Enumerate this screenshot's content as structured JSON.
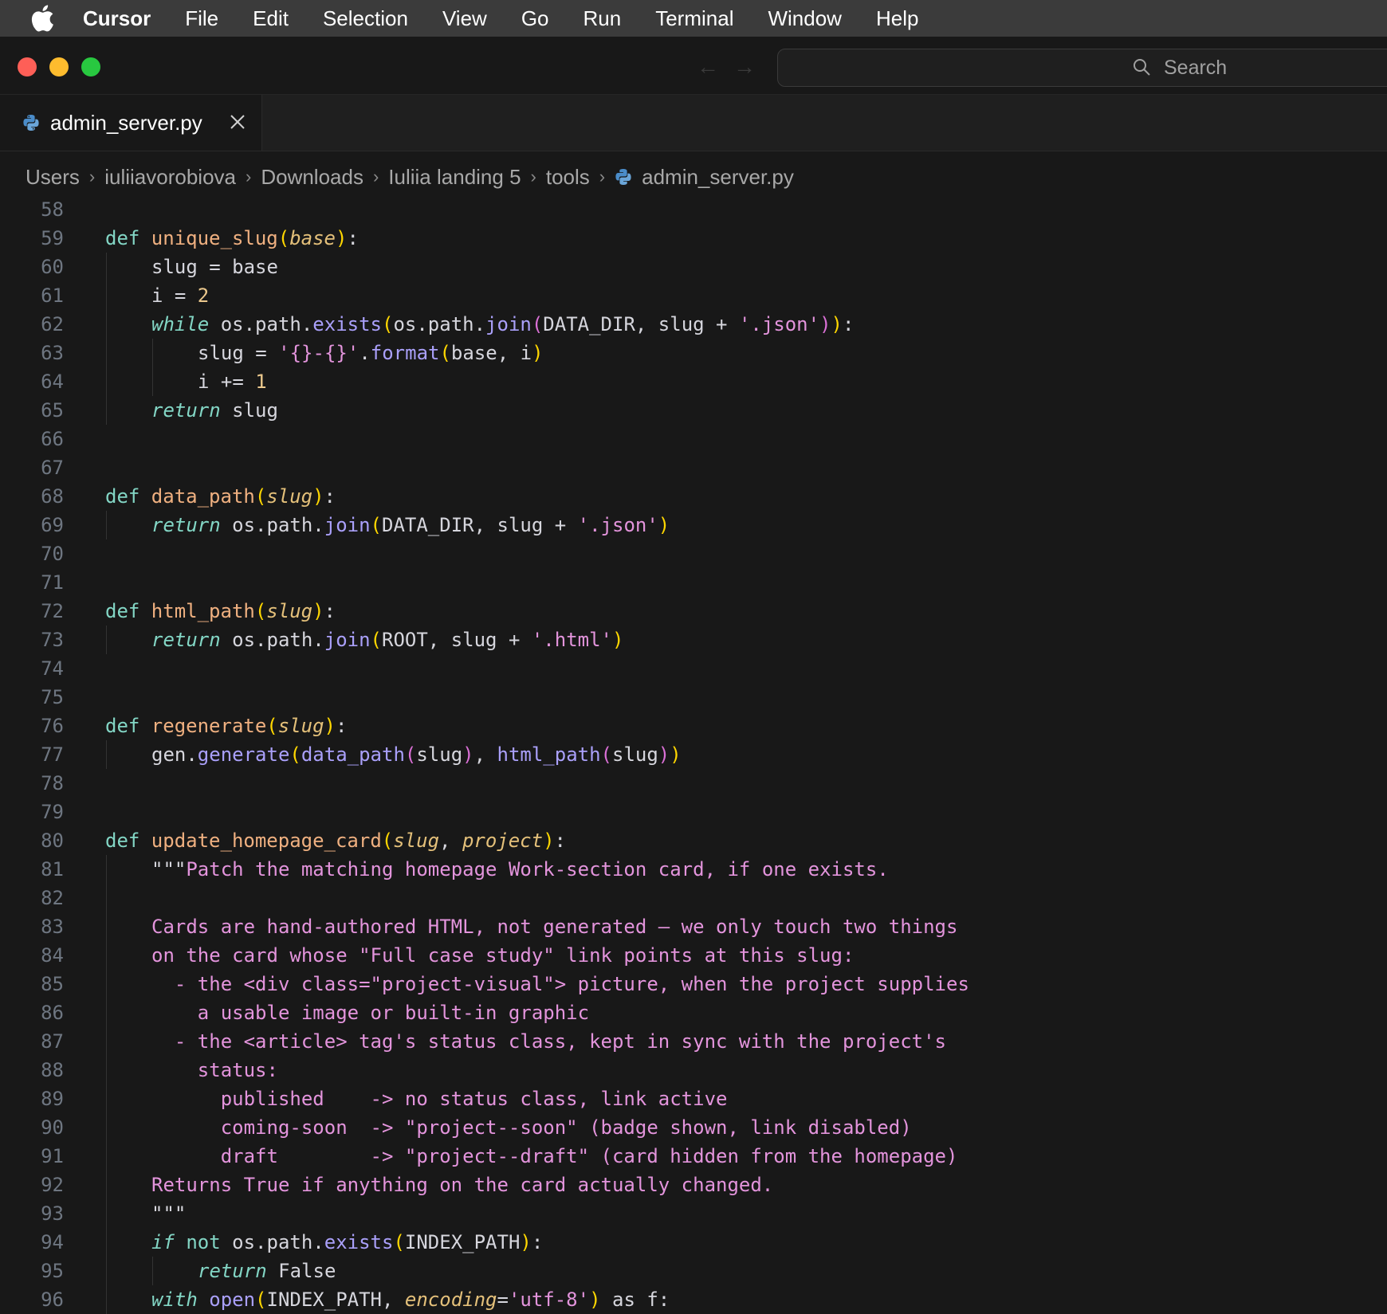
{
  "menubar": {
    "app_name": "Cursor",
    "items": [
      "File",
      "Edit",
      "Selection",
      "View",
      "Go",
      "Run",
      "Terminal",
      "Window",
      "Help"
    ]
  },
  "titlebar": {
    "search_placeholder": "Search"
  },
  "tab": {
    "filename": "admin_server.py"
  },
  "breadcrumb": [
    "Users",
    "iuliiavorobiova",
    "Downloads",
    "Iuliia landing 5",
    "tools",
    "admin_server.py"
  ],
  "colors": {
    "background": "#181818",
    "keyword": "#83d6c5",
    "function": "#efb080",
    "string": "#e394dc",
    "number": "#ebc88d",
    "method": "#aaa0fa"
  },
  "code_lines": [
    {
      "n": "58",
      "indent": 0,
      "tokens": []
    },
    {
      "n": "59",
      "indent": 0,
      "tokens": [
        [
          "kw",
          "def "
        ],
        [
          "fn",
          "unique_slug"
        ],
        [
          "b1",
          "("
        ],
        [
          "par",
          "base"
        ],
        [
          "b1",
          ")"
        ],
        [
          "pl",
          ":"
        ]
      ]
    },
    {
      "n": "60",
      "indent": 1,
      "tokens": [
        [
          "txt",
          "slug = base"
        ]
      ]
    },
    {
      "n": "61",
      "indent": 1,
      "tokens": [
        [
          "txt",
          "i = "
        ],
        [
          "num",
          "2"
        ]
      ]
    },
    {
      "n": "62",
      "indent": 1,
      "tokens": [
        [
          "it",
          "while"
        ],
        [
          "txt",
          " os.path."
        ],
        [
          "call",
          "exists"
        ],
        [
          "b1",
          "("
        ],
        [
          "txt",
          "os.path."
        ],
        [
          "call",
          "join"
        ],
        [
          "b2",
          "("
        ],
        [
          "txt",
          "DATA_DIR, slug + "
        ],
        [
          "str",
          "'.json'"
        ],
        [
          "b2",
          ")"
        ],
        [
          "b1",
          ")"
        ],
        [
          "pl",
          ":"
        ]
      ]
    },
    {
      "n": "63",
      "indent": 2,
      "tokens": [
        [
          "txt",
          "slug = "
        ],
        [
          "str",
          "'{}-{}'"
        ],
        [
          "txt",
          "."
        ],
        [
          "call",
          "format"
        ],
        [
          "b1",
          "("
        ],
        [
          "txt",
          "base, i"
        ],
        [
          "b1",
          ")"
        ]
      ]
    },
    {
      "n": "64",
      "indent": 2,
      "tokens": [
        [
          "txt",
          "i += "
        ],
        [
          "num",
          "1"
        ]
      ]
    },
    {
      "n": "65",
      "indent": 1,
      "tokens": [
        [
          "it",
          "return"
        ],
        [
          "txt",
          " slug"
        ]
      ]
    },
    {
      "n": "66",
      "indent": 0,
      "tokens": []
    },
    {
      "n": "67",
      "indent": 0,
      "tokens": []
    },
    {
      "n": "68",
      "indent": 0,
      "tokens": [
        [
          "kw",
          "def "
        ],
        [
          "fn",
          "data_path"
        ],
        [
          "b1",
          "("
        ],
        [
          "par",
          "slug"
        ],
        [
          "b1",
          ")"
        ],
        [
          "pl",
          ":"
        ]
      ]
    },
    {
      "n": "69",
      "indent": 1,
      "tokens": [
        [
          "it",
          "return"
        ],
        [
          "txt",
          " os.path."
        ],
        [
          "call",
          "join"
        ],
        [
          "b1",
          "("
        ],
        [
          "txt",
          "DATA_DIR, slug + "
        ],
        [
          "str",
          "'.json'"
        ],
        [
          "b1",
          ")"
        ]
      ]
    },
    {
      "n": "70",
      "indent": 0,
      "tokens": []
    },
    {
      "n": "71",
      "indent": 0,
      "tokens": []
    },
    {
      "n": "72",
      "indent": 0,
      "tokens": [
        [
          "kw",
          "def "
        ],
        [
          "fn",
          "html_path"
        ],
        [
          "b1",
          "("
        ],
        [
          "par",
          "slug"
        ],
        [
          "b1",
          ")"
        ],
        [
          "pl",
          ":"
        ]
      ]
    },
    {
      "n": "73",
      "indent": 1,
      "tokens": [
        [
          "it",
          "return"
        ],
        [
          "txt",
          " os.path."
        ],
        [
          "call",
          "join"
        ],
        [
          "b1",
          "("
        ],
        [
          "txt",
          "ROOT, slug + "
        ],
        [
          "str",
          "'.html'"
        ],
        [
          "b1",
          ")"
        ]
      ]
    },
    {
      "n": "74",
      "indent": 0,
      "tokens": []
    },
    {
      "n": "75",
      "indent": 0,
      "tokens": []
    },
    {
      "n": "76",
      "indent": 0,
      "tokens": [
        [
          "kw",
          "def "
        ],
        [
          "fn",
          "regenerate"
        ],
        [
          "b1",
          "("
        ],
        [
          "par",
          "slug"
        ],
        [
          "b1",
          ")"
        ],
        [
          "pl",
          ":"
        ]
      ]
    },
    {
      "n": "77",
      "indent": 1,
      "tokens": [
        [
          "txt",
          "gen."
        ],
        [
          "call",
          "generate"
        ],
        [
          "b1",
          "("
        ],
        [
          "call",
          "data_path"
        ],
        [
          "b2",
          "("
        ],
        [
          "txt",
          "slug"
        ],
        [
          "b2",
          ")"
        ],
        [
          "txt",
          ", "
        ],
        [
          "call",
          "html_path"
        ],
        [
          "b2",
          "("
        ],
        [
          "txt",
          "slug"
        ],
        [
          "b2",
          ")"
        ],
        [
          "b1",
          ")"
        ]
      ]
    },
    {
      "n": "78",
      "indent": 0,
      "tokens": []
    },
    {
      "n": "79",
      "indent": 0,
      "tokens": []
    },
    {
      "n": "80",
      "indent": 0,
      "tokens": [
        [
          "kw",
          "def "
        ],
        [
          "fn",
          "update_homepage_card"
        ],
        [
          "b1",
          "("
        ],
        [
          "par",
          "slug"
        ],
        [
          "txt",
          ", "
        ],
        [
          "par",
          "project"
        ],
        [
          "b1",
          ")"
        ],
        [
          "pl",
          ":"
        ]
      ]
    },
    {
      "n": "81",
      "indent": 1,
      "tokens": [
        [
          "txt",
          "\"\"\""
        ],
        [
          "doc",
          "Patch the matching homepage Work-section card, if one exists."
        ]
      ]
    },
    {
      "n": "82",
      "indent": 1,
      "tokens": []
    },
    {
      "n": "83",
      "indent": 1,
      "tokens": [
        [
          "doc",
          "Cards are hand-authored HTML, not generated — we only touch two things"
        ]
      ]
    },
    {
      "n": "84",
      "indent": 1,
      "tokens": [
        [
          "doc",
          "on the card whose \"Full case study\" link points at this slug:"
        ]
      ]
    },
    {
      "n": "85",
      "indent": 1,
      "tokens": [
        [
          "doc",
          "  - the <div class=\"project-visual\"> picture, when the project supplies"
        ]
      ]
    },
    {
      "n": "86",
      "indent": 1,
      "tokens": [
        [
          "doc",
          "    a usable image or built-in graphic"
        ]
      ]
    },
    {
      "n": "87",
      "indent": 1,
      "tokens": [
        [
          "doc",
          "  - the <article> tag's status class, kept in sync with the project's"
        ]
      ]
    },
    {
      "n": "88",
      "indent": 1,
      "tokens": [
        [
          "doc",
          "    status:"
        ]
      ]
    },
    {
      "n": "89",
      "indent": 1,
      "tokens": [
        [
          "doc",
          "      published    -> no status class, link active"
        ]
      ]
    },
    {
      "n": "90",
      "indent": 1,
      "tokens": [
        [
          "doc",
          "      coming-soon  -> \"project--soon\" (badge shown, link disabled)"
        ]
      ]
    },
    {
      "n": "91",
      "indent": 1,
      "tokens": [
        [
          "doc",
          "      draft        -> \"project--draft\" (card hidden from the homepage)"
        ]
      ]
    },
    {
      "n": "92",
      "indent": 1,
      "tokens": [
        [
          "doc",
          "Returns True if anything on the card actually changed."
        ]
      ]
    },
    {
      "n": "93",
      "indent": 1,
      "tokens": [
        [
          "txt",
          "\"\"\""
        ]
      ]
    },
    {
      "n": "94",
      "indent": 1,
      "tokens": [
        [
          "it",
          "if"
        ],
        [
          "kw",
          " not"
        ],
        [
          "txt",
          " os.path."
        ],
        [
          "call",
          "exists"
        ],
        [
          "b1",
          "("
        ],
        [
          "txt",
          "INDEX_PATH"
        ],
        [
          "b1",
          ")"
        ],
        [
          "pl",
          ":"
        ]
      ]
    },
    {
      "n": "95",
      "indent": 2,
      "tokens": [
        [
          "it",
          "return"
        ],
        [
          "txt",
          " False"
        ]
      ]
    },
    {
      "n": "96",
      "indent": 1,
      "tokens": [
        [
          "it",
          "with"
        ],
        [
          "txt",
          " "
        ],
        [
          "call",
          "open"
        ],
        [
          "b1",
          "("
        ],
        [
          "txt",
          "INDEX_PATH, "
        ],
        [
          "par",
          "encoding"
        ],
        [
          "txt",
          "="
        ],
        [
          "str",
          "'utf-8'"
        ],
        [
          "b1",
          ")"
        ],
        [
          "txt",
          " as f:"
        ]
      ]
    }
  ]
}
